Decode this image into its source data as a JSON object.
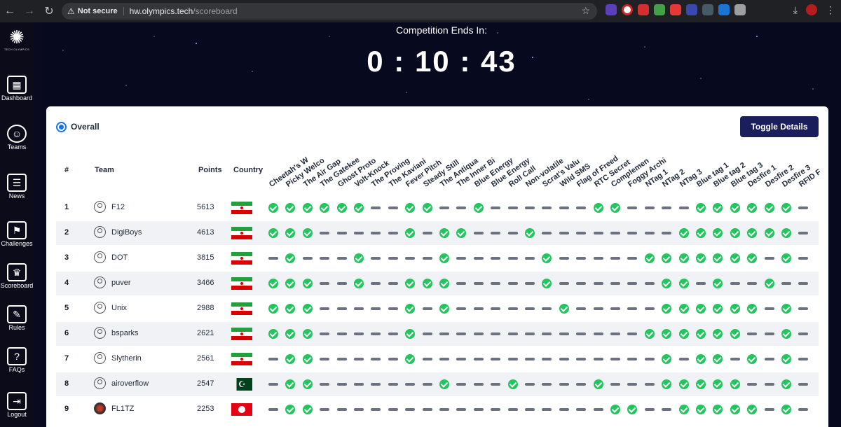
{
  "browser": {
    "not_secure": "Not secure",
    "url_host": "hw.olympics.tech",
    "url_path": "/scoreboard"
  },
  "sidebar": {
    "logo_text": "TECH OLYMPICS",
    "items": [
      {
        "label": "Dashboard",
        "icon": "dashboard-icon"
      },
      {
        "label": "Teams",
        "icon": "teams-icon"
      },
      {
        "label": "News",
        "icon": "news-icon"
      },
      {
        "label": "Challenges",
        "icon": "challenges-icon"
      },
      {
        "label": "Scoreboard",
        "icon": "scoreboard-icon"
      },
      {
        "label": "Rules",
        "icon": "rules-icon"
      },
      {
        "label": "FAQs",
        "icon": "faqs-icon"
      },
      {
        "label": "Logout",
        "icon": "logout-icon"
      }
    ]
  },
  "countdown": {
    "title": "Competition Ends In:",
    "value": "0 : 10 : 43"
  },
  "scoreboard": {
    "filter_label": "Overall",
    "toggle_label": "Toggle Details",
    "headers": {
      "rank": "#",
      "team": "Team",
      "points": "Points",
      "country": "Country"
    },
    "challenges": [
      "Cheetah's W",
      "Picky Welco",
      "The Air Gap",
      "The Gatekee",
      "Ghost Proto",
      "Volt-Knock",
      "The Proving",
      "The Kaviani",
      "Fever Pitch",
      "Steady Still",
      "The Antiqua",
      "The Inner Bi",
      "Blue Energy",
      "Blue Energy",
      "Roll Call",
      "Non-volatile",
      "Scrat's Valu",
      "Wild SMS",
      "Flag of Freed",
      "RTC Secret",
      "Complemen",
      "Foggy Archi",
      "NTag 1",
      "NTag 2",
      "NTag 3",
      "Blue tag 1",
      "Blue tag 2",
      "Blue tag 3",
      "Desfire 1",
      "Desfire 2",
      "Desfire 3",
      "RFID F"
    ],
    "rows": [
      {
        "rank": "1",
        "team": "F12",
        "points": "5613",
        "country": "iran",
        "solves": "111111001100100000011000011111101"
      },
      {
        "rank": "2",
        "team": "DigiBoys",
        "points": "4613",
        "country": "iran",
        "solves": "111000001011000100000000111111101"
      },
      {
        "rank": "3",
        "team": "DOT",
        "points": "3815",
        "country": "iran",
        "solves": "010001000010000010000011111110101"
      },
      {
        "rank": "4",
        "team": "puver",
        "points": "3466",
        "country": "iran",
        "solves": "111001001110000010000001101001000"
      },
      {
        "rank": "5",
        "team": "Unix",
        "points": "2988",
        "country": "iran",
        "solves": "111000001010000001000001111110101"
      },
      {
        "rank": "6",
        "team": "bsparks",
        "points": "2621",
        "country": "iran",
        "solves": "111000001000000000000011111100101"
      },
      {
        "rank": "7",
        "team": "Slytherin",
        "points": "2561",
        "country": "iran",
        "solves": "011000001000000000000001011010101"
      },
      {
        "rank": "8",
        "team": "airoverflow",
        "points": "2547",
        "country": "pakistan",
        "solves": "011000000010001000010001111100100"
      },
      {
        "rank": "9",
        "team": "FL1TZ",
        "points": "2253",
        "country": "tunisia",
        "solves": "011000000000000000001100111110101"
      }
    ]
  }
}
